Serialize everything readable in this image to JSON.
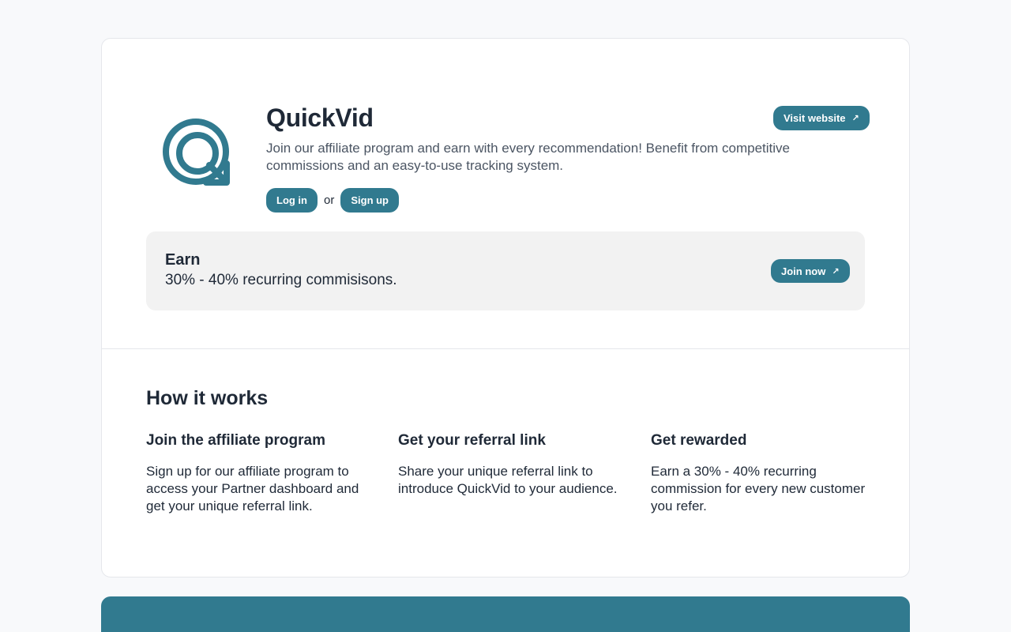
{
  "brand": {
    "name": "QuickVid",
    "description": "Join our affiliate program and earn with every recommendation! Benefit from competitive commissions and an easy-to-use tracking system.",
    "logo_icon": "quickvid-q-logo",
    "accent_color": "#317a8f"
  },
  "header": {
    "visit_label": "Visit website",
    "visit_icon": "arrow-up-right-icon"
  },
  "auth": {
    "login_label": "Log in",
    "or_text": "or",
    "signup_label": "Sign up"
  },
  "earn": {
    "title": "Earn",
    "text": "30% - 40% recurring commisisons.",
    "join_label": "Join now"
  },
  "how": {
    "title": "How it works",
    "steps": [
      {
        "title": "Join the affiliate program",
        "text": "Sign up for our affiliate program to access your Partner dashboard and get your unique referral link."
      },
      {
        "title": "Get your referral link",
        "text": "Share your unique referral link to introduce QuickVid to your audience."
      },
      {
        "title": "Get rewarded",
        "text": "Earn a 30% - 40% recurring commission for every new customer you refer."
      }
    ]
  }
}
